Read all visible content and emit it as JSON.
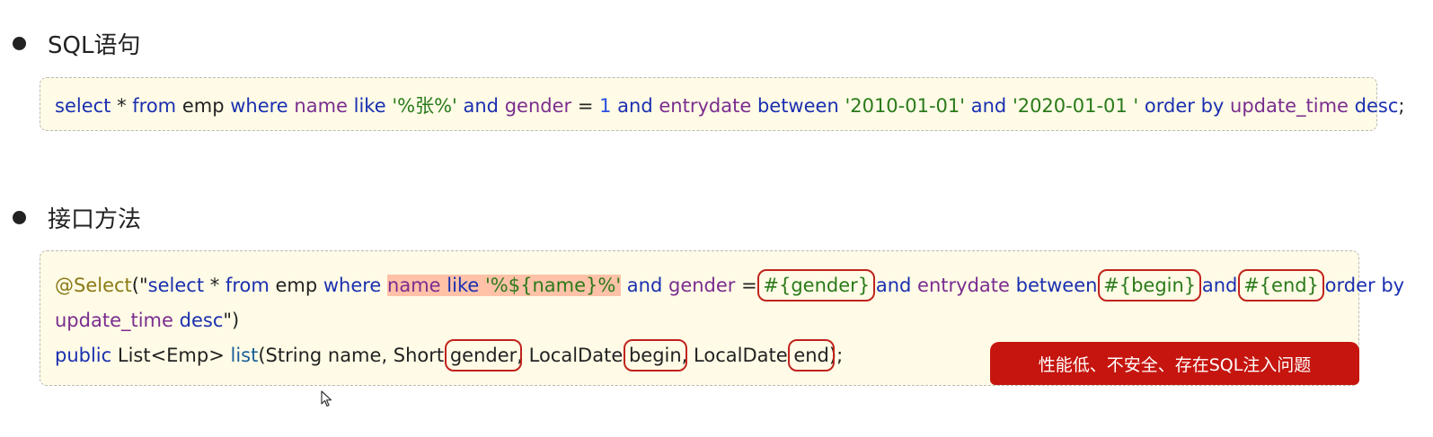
{
  "sections": {
    "sql": {
      "title": "SQL语句"
    },
    "interface": {
      "title": "接口方法"
    }
  },
  "sql_box": {
    "t1": "select",
    "t2": " * ",
    "t3": "from",
    "t4": " emp ",
    "t5": "where",
    "t6": " ",
    "t7": "name",
    "t8": " ",
    "t9": "like",
    "t10": " ",
    "t11": "'%张%'",
    "t12": " ",
    "t13": "and",
    "t14": " ",
    "t15": "gender",
    "t16": " = ",
    "t17": "1",
    "t18": " ",
    "t19": "and",
    "t20": " ",
    "t21": "entrydate",
    "t22": " ",
    "t23": "between",
    "t24": " ",
    "t25": "'2010-01-01'",
    "t26": " ",
    "t27": "and",
    "t28": " ",
    "t29": "'2020-01-01 '",
    "t30": " ",
    "t31": "order by",
    "t32": " ",
    "t33": "update_time",
    "t34": " ",
    "t35": "desc",
    "t36": ";"
  },
  "method_box": {
    "l1": {
      "a": "@Select",
      "b": "(\"",
      "c": "select",
      "d": " * ",
      "e": "from",
      "f": " emp ",
      "g": "where",
      "h": " ",
      "i": "name",
      "j": " ",
      "k": "like",
      "l": " ",
      "m": "'%${name}%'",
      "n": " ",
      "o": "and",
      "p": " ",
      "q": "gender",
      "r": " = ",
      "s": "#{gender}",
      "t": " ",
      "u": "and",
      "v": " ",
      "w": "entrydate",
      "x": " ",
      "y": "between",
      "z": " ",
      "aa": "#{begin}",
      "ab": " ",
      "ac": "and",
      "ad": " ",
      "ae": "#{end}",
      "af": " ",
      "ag": "order by"
    },
    "l2": {
      "a": "update_time",
      "b": " ",
      "c": "desc",
      "d": "\")"
    },
    "l3": {
      "a": "public",
      "b": " List<Emp> ",
      "c": "list",
      "d": "(String name, Short ",
      "e": "gender",
      "f": ", LocalDate ",
      "g": "begin",
      "h": ", LocalDate ",
      "i": "end",
      "j": ");"
    }
  },
  "warning": "性能低、不安全、存在SQL注入问题"
}
